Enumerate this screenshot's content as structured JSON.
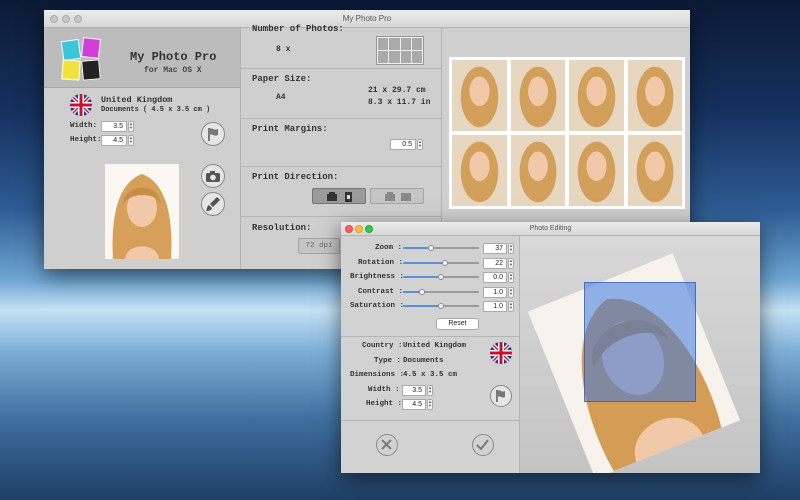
{
  "main_window": {
    "title": "My Photo Pro",
    "app_name": "My Photo Pro",
    "app_subtitle": "for Mac OS X",
    "country": "United Kingdom",
    "document": "Documents ( 4.5 x 3.5 cm )",
    "width_label": "Width:",
    "width_value": "3.5",
    "height_label": "Height:",
    "height_value": "4.5",
    "photos_header": "Number of Photos:",
    "photos_count": "8 x",
    "paper_header": "Paper Size:",
    "paper_name": "A4",
    "paper_cm": "21 x 29.7 cm",
    "paper_in": "8.3 x 11.7 in",
    "margins_header": "Print Margins:",
    "margins_value": "0.5",
    "direction_header": "Print Direction:",
    "resolution_header": "Resolution:",
    "resolution_value": "72 dpi"
  },
  "editing_window": {
    "title": "Photo Editing",
    "zoom_label": "Zoom :",
    "zoom_value": "37",
    "rotation_label": "Rotation :",
    "rotation_value": "22",
    "brightness_label": "Brightness :",
    "brightness_value": "0.0",
    "contrast_label": "Contrast :",
    "contrast_value": "1.0",
    "saturation_label": "Saturation :",
    "saturation_value": "1.0",
    "reset_label": "Reset",
    "country_label": "Country :",
    "country_value": "United Kingdom",
    "type_label": "Type :",
    "type_value": "Documents",
    "dimensions_label": "Dimensions :",
    "dimensions_value": "4.5 x 3.5 cm",
    "width_label": "Width :",
    "width_value": "3.5",
    "height_label": "Height :",
    "height_value": "4.5"
  },
  "sliders": {
    "zoom": 0.37,
    "rotation": 0.55,
    "brightness": 0.5,
    "contrast": 0.25,
    "saturation": 0.5
  },
  "icons": [
    "app-logo-icon",
    "flag-uk-icon",
    "flag-icon",
    "camera-icon",
    "brush-icon",
    "printer-icon",
    "cancel-icon",
    "confirm-icon",
    "passport-grid-icon"
  ],
  "colors": {
    "accent": "#5a8fd6",
    "crop_overlay": "#3d7ae0"
  }
}
